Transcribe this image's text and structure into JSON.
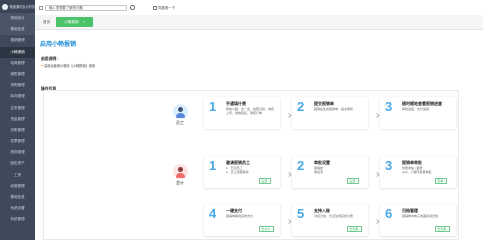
{
  "app": {
    "logo_text": "畅捷通好会计财务",
    "sidebar": [
      {
        "label": "常用统计",
        "sub": true,
        "active": false
      },
      {
        "label": "基础信息",
        "sub": true,
        "active": false
      },
      {
        "label": "报销管理",
        "sub": false,
        "active": false
      },
      {
        "label": "小畅报销",
        "sub": false,
        "active": true
      },
      {
        "label": "电商管理",
        "sub": false,
        "active": false
      },
      {
        "label": "销售管理",
        "sub": false,
        "active": false
      },
      {
        "label": "采购管理",
        "sub": false,
        "active": false
      },
      {
        "label": "库存管理",
        "sub": false,
        "active": false
      },
      {
        "label": "往来管理",
        "sub": false,
        "active": false
      },
      {
        "label": "资金管理",
        "sub": false,
        "active": false
      },
      {
        "label": "总账管理",
        "sub": false,
        "active": false
      },
      {
        "label": "发票管理",
        "sub": false,
        "active": false
      },
      {
        "label": "税务管理",
        "sub": false,
        "active": false
      },
      {
        "label": "固定资产",
        "sub": false,
        "active": false
      },
      {
        "label": "工资",
        "sub": false,
        "active": false
      },
      {
        "label": "经营管理",
        "sub": false,
        "active": false
      },
      {
        "label": "基础信息",
        "sub": false,
        "active": false
      },
      {
        "label": "系统设置",
        "sub": false,
        "active": false
      },
      {
        "label": "系统管理",
        "sub": false,
        "active": false
      }
    ]
  },
  "topbar": {
    "search_value": "输入您想要了解的问题",
    "company": "同集团一下"
  },
  "tabs": [
    {
      "label": "首页",
      "active": false
    },
    {
      "label": "小畅报销",
      "active": true,
      "close": "×"
    }
  ],
  "page": {
    "title": "启用小畅报销",
    "desc_title": "启用说明：",
    "desc_text": "启用后使用小程序【小畅报销】费用",
    "guide_title": "操作引导"
  },
  "roles": [
    {
      "label": "员工",
      "gender": "m"
    },
    {
      "label": "会计",
      "gender": "f"
    }
  ],
  "cards": [
    {
      "num": "1",
      "title": "手通填什费",
      "desc": "微信小程、会一会、拍照识别、电费上传，微信链接、审核打单",
      "go": ""
    },
    {
      "num": "2",
      "title": "提交报销单",
      "desc": "报销后生成报销单、提交审核",
      "go": ""
    },
    {
      "num": "3",
      "title": "随时随地查看报销进度",
      "desc": "审批进度、支付进度",
      "go": ""
    },
    {
      "num": "1",
      "title": "邀请报销员工",
      "desc": "1、已同员工\n2、员工线路邀请",
      "go": "设置 ›"
    },
    {
      "num": "2",
      "title": "审批设置",
      "desc": "报销类\n审批流",
      "go": "设置 ›"
    },
    {
      "num": "3",
      "title": "报销单审批",
      "desc": "批量收缩 / 报账\nweb、小程序批量审批",
      "go": "查看 ›"
    },
    {
      "num": "4",
      "title": "一键支付",
      "desc": "报销单审批完成支付",
      "go": "去支付 ›"
    },
    {
      "num": "5",
      "title": "支持入账",
      "desc": "对接日常、凭证生成完成记账",
      "go": "去查看 ›"
    },
    {
      "num": "6",
      "title": "归档管理",
      "desc": "报销单中电子发票自动归档",
      "go": "去查看 ›"
    }
  ]
}
